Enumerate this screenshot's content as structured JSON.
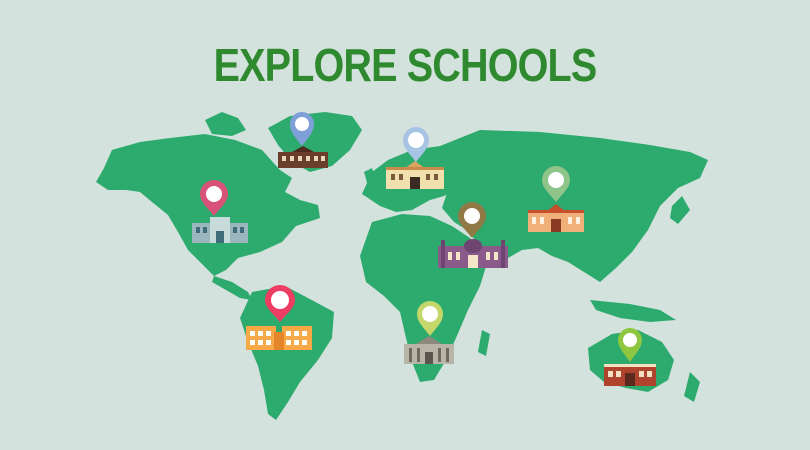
{
  "page": {
    "title": "EXPLORE SCHOOLS",
    "title_color": "#2f8a2f",
    "background": "#d3e2dc"
  },
  "map": {
    "land_color": "#2dab6e"
  },
  "markers": [
    {
      "id": "greenland",
      "pin_color": "#7f9fd8",
      "building": "dark-brown-house-icon"
    },
    {
      "id": "europe",
      "pin_color": "#a8c4e4",
      "building": "cream-palace-icon"
    },
    {
      "id": "north-america",
      "pin_color": "#d8527a",
      "building": "teal-school-icon"
    },
    {
      "id": "asia",
      "pin_color": "#8fc48a",
      "building": "orange-hall-icon"
    },
    {
      "id": "middle-east",
      "pin_color": "#8f7a45",
      "building": "purple-mosque-icon"
    },
    {
      "id": "south-america",
      "pin_color": "#ee3d62",
      "building": "orange-twin-school-icon"
    },
    {
      "id": "africa",
      "pin_color": "#c3d76a",
      "building": "gray-colonnade-icon"
    },
    {
      "id": "australia",
      "pin_color": "#8ec63f",
      "building": "brown-school-icon"
    }
  ]
}
